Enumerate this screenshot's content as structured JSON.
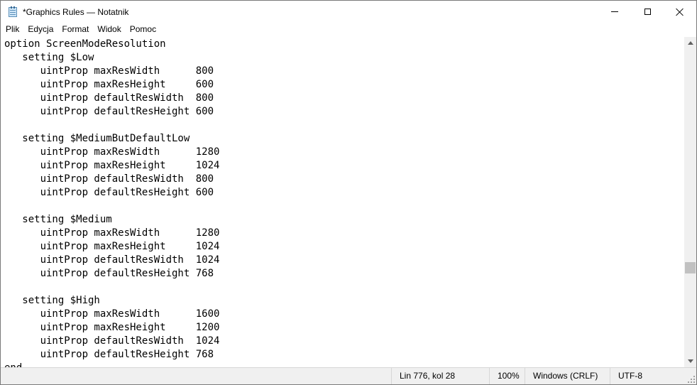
{
  "window": {
    "title": "*Graphics Rules — Notatnik"
  },
  "menu": {
    "items": [
      "Plik",
      "Edycja",
      "Format",
      "Widok",
      "Pomoc"
    ]
  },
  "editor": {
    "lines": [
      "option ScreenModeResolution",
      "   setting $Low",
      "      uintProp maxResWidth      800",
      "      uintProp maxResHeight     600",
      "      uintProp defaultResWidth  800",
      "      uintProp defaultResHeight 600",
      "",
      "   setting $MediumButDefaultLow",
      "      uintProp maxResWidth      1280",
      "      uintProp maxResHeight     1024",
      "      uintProp defaultResWidth  800",
      "      uintProp defaultResHeight 600",
      "",
      "   setting $Medium",
      "      uintProp maxResWidth      1280",
      "      uintProp maxResHeight     1024",
      "      uintProp defaultResWidth  1024",
      "      uintProp defaultResHeight 768",
      "",
      "   setting $High",
      "      uintProp maxResWidth      1600",
      "      uintProp maxResHeight     1200",
      "      uintProp defaultResWidth  1024",
      "      uintProp defaultResHeight 768",
      "end"
    ],
    "scroll_position": 0.72
  },
  "status": {
    "position": "Lin 776, kol 28",
    "zoom": "100%",
    "line_endings": "Windows (CRLF)",
    "encoding": "UTF-8"
  },
  "icons": {
    "app": "notepad-icon",
    "minimize": "minimize-icon",
    "maximize": "maximize-icon",
    "close": "close-icon"
  }
}
